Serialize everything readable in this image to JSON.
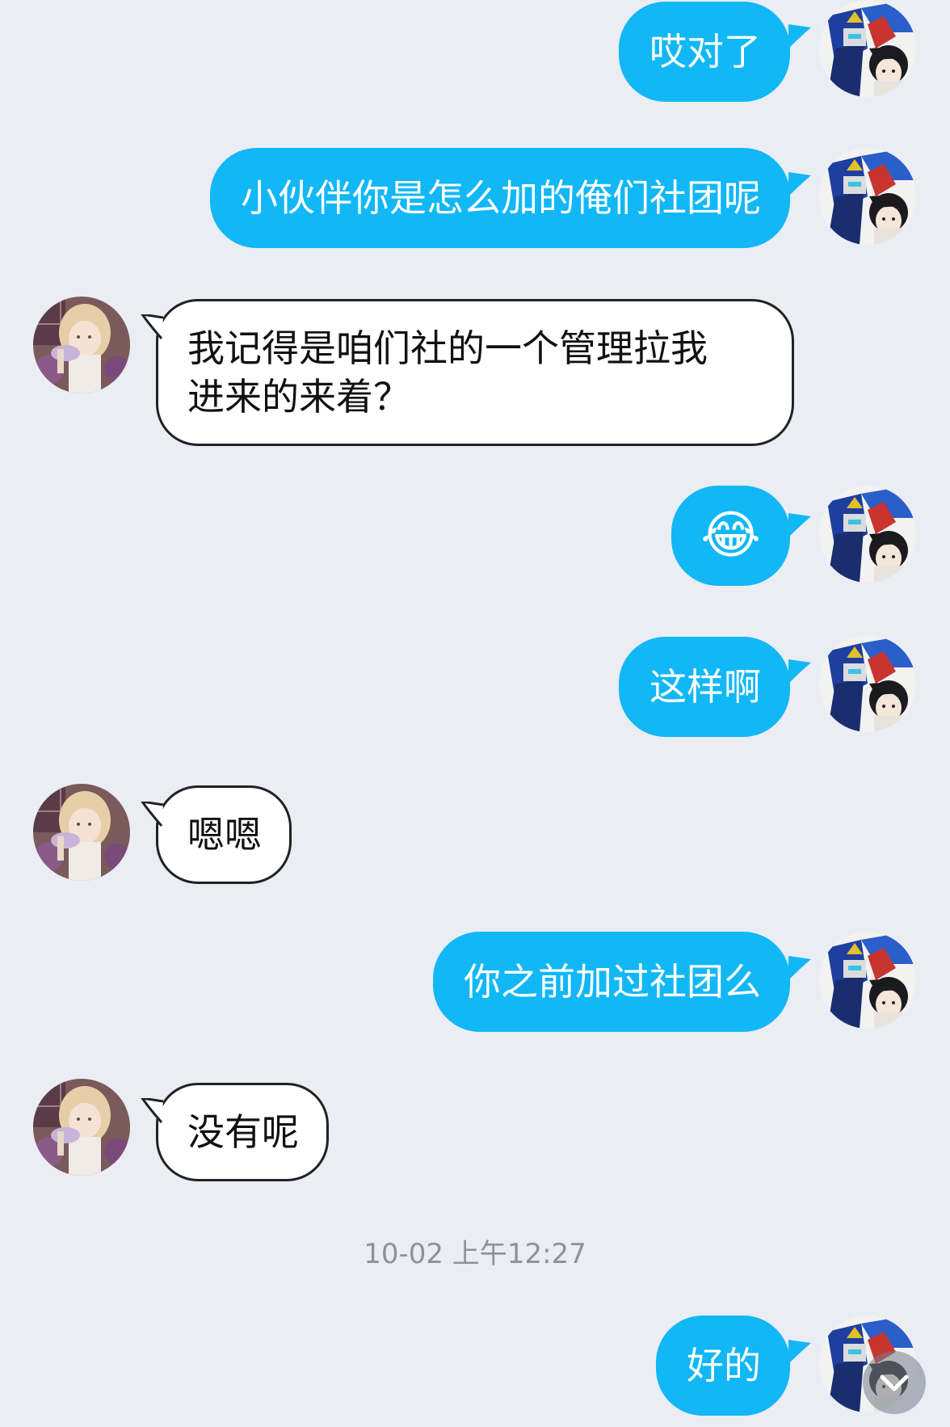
{
  "messages": [
    {
      "side": "out",
      "text": "哎对了"
    },
    {
      "side": "out",
      "text": "小伙伴你是怎么加的俺们社团呢"
    },
    {
      "side": "in",
      "text": "我记得是咱们社的一个管理拉我\n进来的来着？"
    },
    {
      "side": "out",
      "emoji": "😂"
    },
    {
      "side": "out",
      "text": "这样啊"
    },
    {
      "side": "in",
      "text": "嗯嗯"
    },
    {
      "side": "out",
      "text": "你之前加过社团么"
    },
    {
      "side": "in",
      "text": "没有呢"
    },
    {
      "side": "out",
      "text": "好的"
    }
  ],
  "timestamp": "10-02 上午12:27",
  "colors": {
    "background": "#ebedf5",
    "outgoing_bubble": "#12b7f5",
    "incoming_bubble": "#ffffff"
  },
  "icons": {
    "self_avatar": "gundam-avatar-icon",
    "other_avatar": "anime-girl-avatar-icon",
    "scroll_down": "chevron-down-icon"
  }
}
